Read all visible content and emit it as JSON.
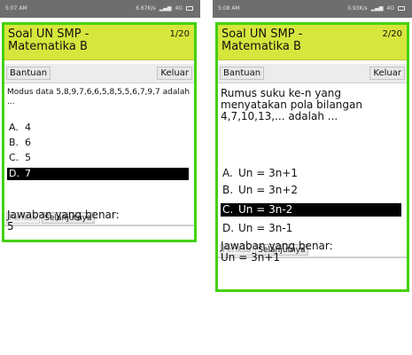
{
  "left": {
    "status": {
      "time": "5:07 AM",
      "right_text": "6.67K/s",
      "signal": "4G"
    },
    "title": "Soal UN SMP - Matematika B",
    "counter": "1/20",
    "toolbar": {
      "help": "Bantuan",
      "exit": "Keluar"
    },
    "question": "Modus data 5,8,9,7,6,6,5,8,5,5,6,7,9,7 adalah ...",
    "options": [
      {
        "letter": "A.",
        "text": "4",
        "selected": false
      },
      {
        "letter": "B.",
        "text": "6",
        "selected": false
      },
      {
        "letter": "C.",
        "text": "5",
        "selected": false
      },
      {
        "letter": "D.",
        "text": "7",
        "selected": true
      }
    ],
    "actions": {
      "check": "Periksa",
      "next": "Selanjutnya"
    },
    "answer_label": "Jawaban yang benar:",
    "answer_value": "5"
  },
  "right": {
    "status": {
      "time": "5:08 AM",
      "right_text": "0.93K/s",
      "signal": "4G"
    },
    "title": "Soal UN SMP - Matematika B",
    "counter": "2/20",
    "toolbar": {
      "help": "Bantuan",
      "exit": "Keluar"
    },
    "question": "Rumus suku ke-n yang menyatakan pola bilangan 4,7,10,13,... adalah ...",
    "options": [
      {
        "letter": "A.",
        "text": "Un = 3n+1",
        "selected": false
      },
      {
        "letter": "B.",
        "text": "Un = 3n+2",
        "selected": false
      },
      {
        "letter": "C.",
        "text": "Un = 3n-2",
        "selected": true
      },
      {
        "letter": "D.",
        "text": "Un = 3n-1",
        "selected": false
      }
    ],
    "actions": {
      "check": "Periksa",
      "next": "Selanjutnya"
    },
    "answer_label": "Jawaban yang benar:",
    "answer_value": "Un = 3n+1"
  },
  "colors": {
    "header": "#d6e63c",
    "border": "#44d10d",
    "selected": "#000000"
  },
  "icons": {
    "battery": "battery-icon",
    "signal": "signal-icon"
  }
}
